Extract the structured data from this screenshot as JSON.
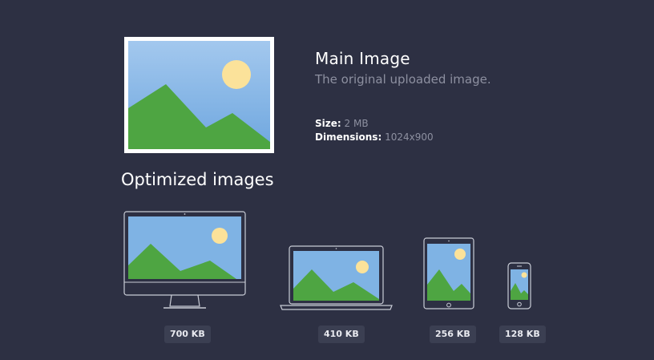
{
  "main_image": {
    "title": "Main Image",
    "subtitle": "The original uploaded image.",
    "size_label": "Size:",
    "size_value": "2 MB",
    "dimensions_label": "Dimensions:",
    "dimensions_value": "1024x900"
  },
  "optimized": {
    "heading": "Optimized images",
    "devices": [
      {
        "kind": "desktop-monitor",
        "size": "700 KB"
      },
      {
        "kind": "laptop",
        "size": "410 KB"
      },
      {
        "kind": "tablet",
        "size": "256 KB"
      },
      {
        "kind": "phone",
        "size": "128 KB"
      }
    ]
  },
  "colors": {
    "background": "#2d3043",
    "sky": "#7fb3e4",
    "mountain": "#4ea542",
    "sun": "#fbe29a",
    "device_outline": "#c9ccd6",
    "muted_text": "#8d90a0",
    "badge_bg": "#3b3f52"
  }
}
